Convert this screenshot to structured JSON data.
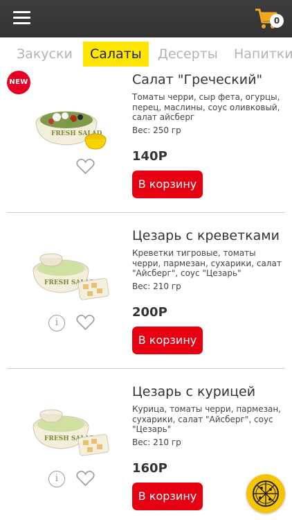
{
  "header": {
    "menu_icon": "hamburger-menu-icon",
    "cart_icon": "shopping-cart-icon",
    "cart_count": "0",
    "accent_color": "#f5a623"
  },
  "tabs": [
    {
      "label": "Закуски",
      "active": false
    },
    {
      "label": "Салаты",
      "active": true
    },
    {
      "label": "Десерты",
      "active": false
    },
    {
      "label": "Напитки",
      "active": false
    }
  ],
  "products": [
    {
      "badge": "NEW",
      "title": "Салат \"Греческий\"",
      "description": "Томаты черри, сыр фета, огурцы, перец, маслины, соус оливковый, салат айсберг",
      "weight": "Вес: 250 гр",
      "price": "140Р",
      "button": "В корзину",
      "image_label": "FRESH SALAD"
    },
    {
      "title": "Цезарь с креветками",
      "description": "Креветки тигровые, томаты черри, пармезан, сухарики, салат \"Айсберг\", соус \"Цезарь\"",
      "weight": "Вес: 210 гр",
      "price": "200Р",
      "button": "В корзину",
      "info_label": "i",
      "image_label": "FRESH SALAD"
    },
    {
      "title": "Цезарь с курицей",
      "description": "Курица, томаты черри, пармезан, сухарики, салат \"Айсберг\", соус \"Цезарь\"",
      "weight": "Вес: 210 гр",
      "price": "160Р",
      "button": "В корзину",
      "info_label": "i",
      "image_label": "FRESH SALAD"
    }
  ],
  "colors": {
    "header_bg": "#3a3a3a",
    "active_tab": "#ffe600",
    "button": "#e60012",
    "badge": "#e60023",
    "fab": "#f5c400"
  }
}
